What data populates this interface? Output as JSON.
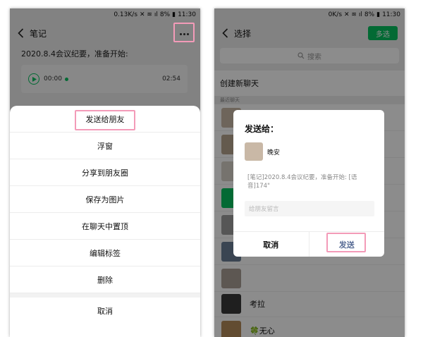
{
  "left": {
    "status": {
      "speed": "0.13K/s",
      "battery": "8%",
      "time": "11:30"
    },
    "title": "笔记",
    "note_text": "2020.8.4会议纪要，准备开始:",
    "player": {
      "start": "00:00",
      "end": "02:54"
    },
    "menu": [
      "发送给朋友",
      "浮窗",
      "分享到朋友圈",
      "保存为图片",
      "在聊天中置顶",
      "编辑标签",
      "删除"
    ],
    "cancel": "取消"
  },
  "right": {
    "status": {
      "speed": "0K/s",
      "battery": "8%",
      "time": "11:30"
    },
    "title": "选择",
    "multi_select": "多选",
    "search_placeholder": "搜索",
    "new_chat": "创建新聊天",
    "recent_label": "最近聊天",
    "contacts": [
      {
        "name": "考拉"
      },
      {
        "name": "🍀无心"
      }
    ],
    "dialog": {
      "title": "发送给：",
      "contact_name": "晚安",
      "preview": "[笔记]2020.8.4会议纪要，准备开始: [语音]174\"",
      "message_placeholder": "给朋友留言",
      "cancel": "取消",
      "send": "发送"
    }
  },
  "colors": {
    "wechat_green": "#07c160",
    "highlight_pink": "#f39bb8",
    "link_blue": "#576b95"
  }
}
